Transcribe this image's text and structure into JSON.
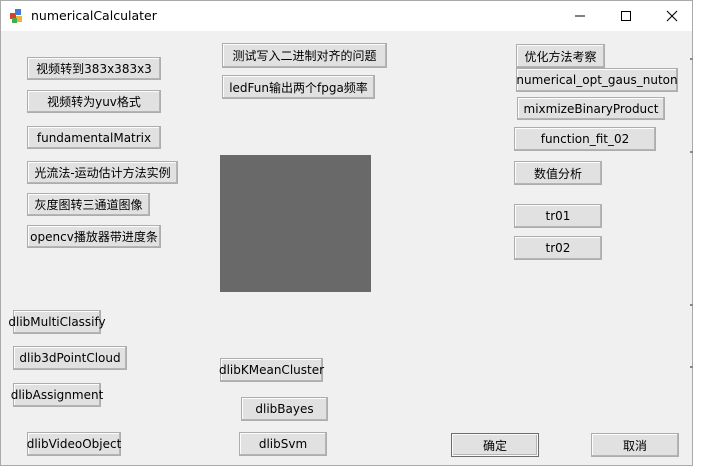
{
  "window": {
    "title": "numericalCalculater",
    "controls": {
      "minimize": "—",
      "maximize": "☐",
      "close": "✕"
    }
  },
  "buttons": {
    "video_to_383": "视频转到383x383x3",
    "video_to_yuv": "视频转为yuv格式",
    "fundamental_matrix": "fundamentalMatrix",
    "optical_flow": "光流法-运动估计方法实例",
    "gray_to_3ch": "灰度图转三通道图像",
    "opencv_player": "opencv播放器带进度条",
    "test_binary_align": "测试写入二进制对齐的问题",
    "led_fun": "ledFun输出两个fpga频率",
    "optim_methods": "优化方法考察",
    "numerical_opt": "numerical_opt_gaus_nuton",
    "mixmize_binary": "mixmizeBinaryProduct",
    "function_fit": "function_fit_02",
    "numeric_analysis": "数值分析",
    "tr01": "tr01",
    "tr02": "tr02",
    "dlib_multi_classify": "dlibMultiClassify",
    "dlib_3d_point_cloud": "dlib3dPointCloud",
    "dlib_assignment": "dlibAssignment",
    "dlib_video_object": "dlibVideoObject",
    "dlib_kmean_cluster": "dlibKMeanCluster",
    "dlib_bayes": "dlibBayes",
    "dlib_svm": "dlibSvm",
    "ok": "确定",
    "cancel": "取消"
  },
  "colors": {
    "dialog_bg": "#f0f0f0",
    "preview_bg": "#696969",
    "button_bg": "#e1e1e1",
    "button_border": "#adadad"
  }
}
